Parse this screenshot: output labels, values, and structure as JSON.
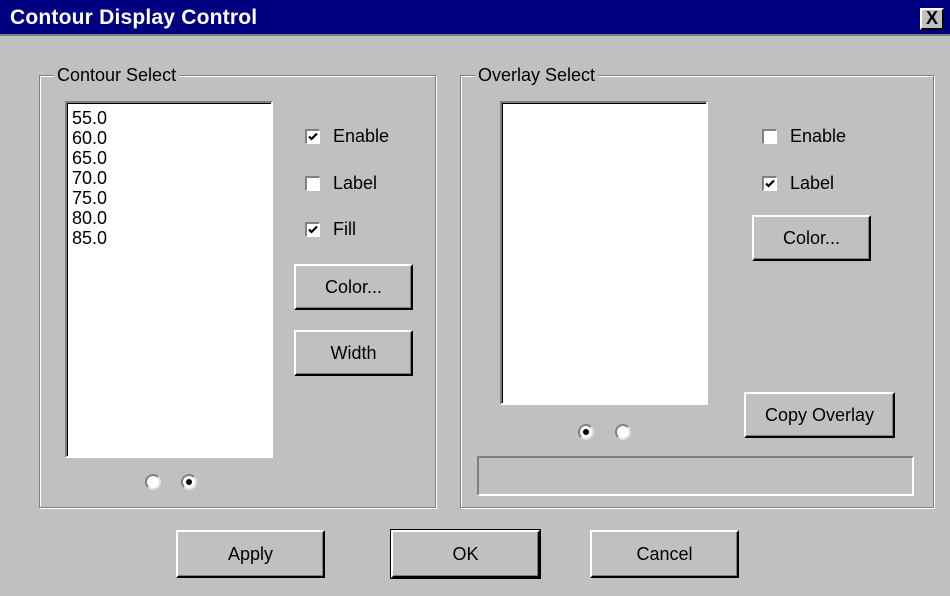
{
  "window": {
    "title": "Contour Display Control",
    "close_label": "X"
  },
  "contour": {
    "group_label": "Contour Select",
    "levels": [
      "55.0",
      "60.0",
      "65.0",
      "70.0",
      "75.0",
      "80.0",
      "85.0"
    ],
    "enable_label": "Enable",
    "enable_checked": true,
    "label_label": "Label",
    "label_checked": false,
    "fill_label": "Fill",
    "fill_checked": true,
    "color_button": "Color...",
    "width_button": "Width",
    "radio_selected": 1
  },
  "overlay": {
    "group_label": "Overlay Select",
    "items": [],
    "enable_label": "Enable",
    "enable_checked": false,
    "label_label": "Label",
    "label_checked": true,
    "color_button": "Color...",
    "copy_button": "Copy Overlay",
    "radio_selected": 0,
    "text_value": ""
  },
  "footer": {
    "apply": "Apply",
    "ok": "OK",
    "cancel": "Cancel"
  }
}
